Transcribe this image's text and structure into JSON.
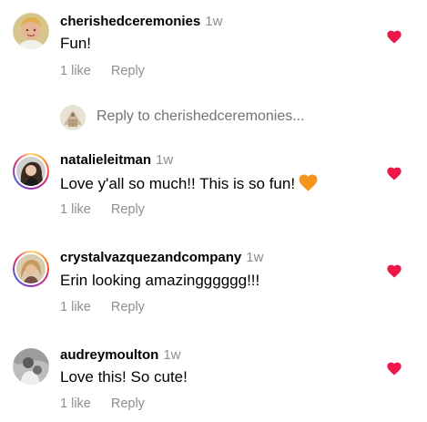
{
  "comments": [
    {
      "username": "cherishedceremonies",
      "time": "1w",
      "text": "Fun!",
      "likes": "1 like",
      "reply": "Reply",
      "avatar": "avatar-cherishedceremonies"
    },
    {
      "username": "natalieleitman",
      "time": "1w",
      "text": "Love y'all so much!! This is so fun!",
      "emoji": "orange-heart-icon",
      "likes": "1 like",
      "reply": "Reply",
      "avatar": "avatar-natalieleitman"
    },
    {
      "username": "crystalvazquezandcompany",
      "time": "1w",
      "text": "Erin looking amazingggggg!!!",
      "likes": "1 like",
      "reply": "Reply",
      "avatar": "avatar-crystalvazquezandcompany"
    },
    {
      "username": "audreymoulton",
      "time": "1w",
      "text": "Love this! So cute!",
      "likes": "1 like",
      "reply": "Reply",
      "avatar": "avatar-audreymoulton"
    }
  ],
  "reply_thread": {
    "label": "Reply to cherishedceremonies..."
  },
  "colors": {
    "like_heart": "#ed1849",
    "secondary_text": "#8e8e8e",
    "orange_heart": "#f7941d"
  },
  "icons": {
    "like": "heart-icon"
  }
}
